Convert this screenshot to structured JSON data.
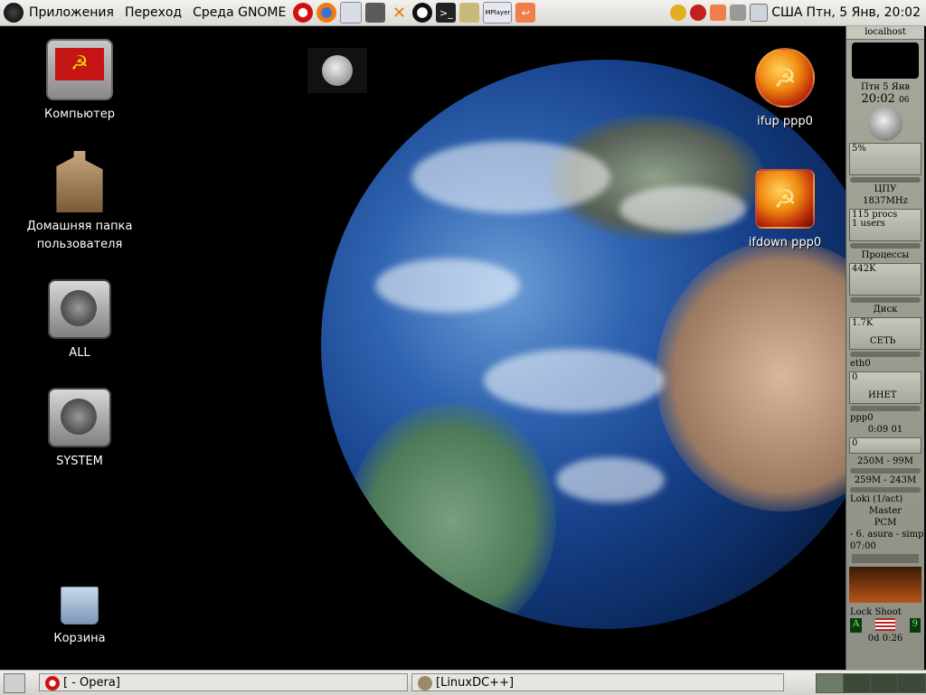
{
  "top_panel": {
    "menus": [
      "Приложения",
      "Переход",
      "Среда GNOME"
    ],
    "launchers": [
      "opera-icon",
      "firefox-icon",
      "mail-icon",
      "file-manager-icon",
      "x-icon",
      "penguin-icon",
      "terminal-icon",
      "notes-icon",
      "mplayer-icon",
      "app-icon"
    ],
    "mplayer_label": "MPlayer",
    "tray": {
      "keyboard_layout": "США",
      "clock": "Птн,  5 Янв, 20:02"
    }
  },
  "desktop_icons": [
    {
      "label": "Компьютер"
    },
    {
      "label": "Домашняя папка пользователя"
    },
    {
      "label": "ALL"
    },
    {
      "label": "SYSTEM"
    },
    {
      "label": "Корзина"
    },
    {
      "label": "ifup ppp0"
    },
    {
      "label": "ifdown ppp0"
    }
  ],
  "gkrellm": {
    "hostname": "localhost",
    "date_day": "Птн",
    "date_num": "5",
    "date_month": "Янв",
    "time": "20:02",
    "time_sec": "06",
    "cpu_pct": "5%",
    "cpu_label": "ЦПУ",
    "cpu_freq": "1837MHz",
    "procs": "115 procs",
    "users": "1 users",
    "procs_label": "Процессы",
    "disk_val": "442K",
    "disk_label": "Диск",
    "net_val": "1.7K",
    "net_label": "СЕТЬ",
    "eth0": "eth0",
    "eth0_val": "0",
    "inet_label": "ИНЕТ",
    "ppp0": "ppp0",
    "ppp0_time": "0:09",
    "ppp0_num": "01",
    "ppp0_val": "0",
    "mem1": "250M - 99M",
    "mem2": "259M - 243M",
    "sensor": "Loki (1/act)",
    "vol_master": "Master",
    "vol_pcm": "PCM",
    "track": "- 6. asura - simp",
    "track_time": "07:00",
    "lock_label": "Lock",
    "shoot_label": "Shoot",
    "badge_a": "A",
    "badge_9": "9",
    "uptime": "0d  0:26"
  },
  "taskbar": {
    "tasks": [
      "[                                                     - Opera]",
      "[LinuxDC++]"
    ]
  }
}
